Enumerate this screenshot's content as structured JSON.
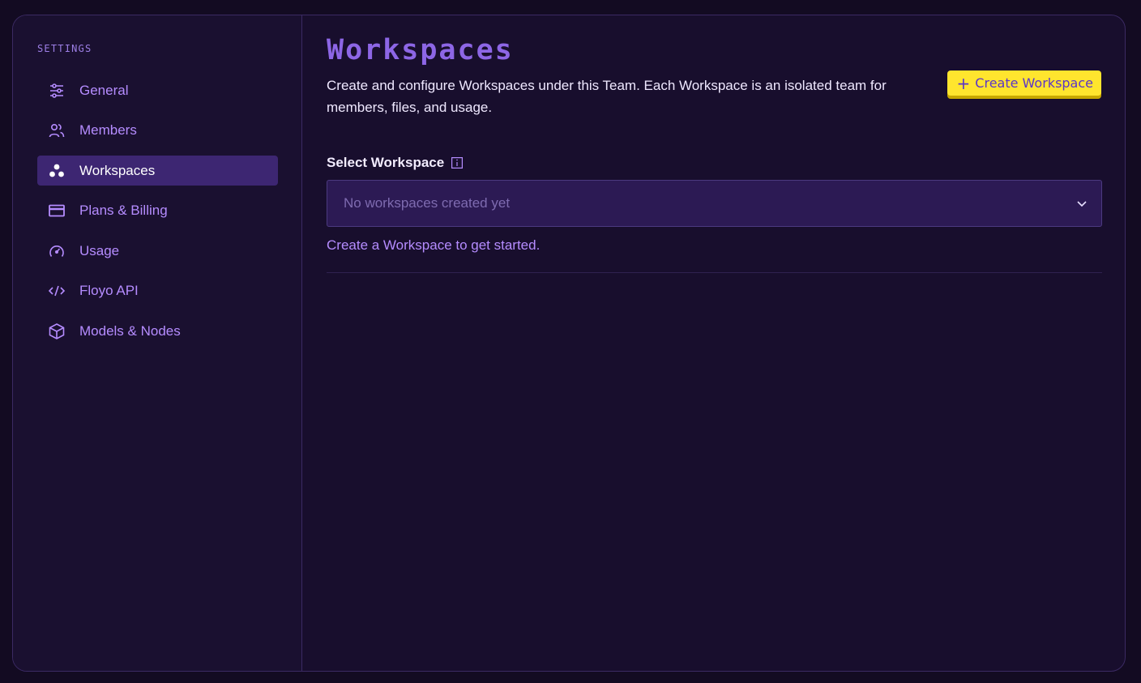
{
  "sidebar": {
    "heading": "SETTINGS",
    "items": [
      {
        "label": "General",
        "icon": "sliders-icon",
        "active": false
      },
      {
        "label": "Members",
        "icon": "users-icon",
        "active": false
      },
      {
        "label": "Workspaces",
        "icon": "workspaces-icon",
        "active": true
      },
      {
        "label": "Plans & Billing",
        "icon": "credit-card-icon",
        "active": false
      },
      {
        "label": "Usage",
        "icon": "gauge-icon",
        "active": false
      },
      {
        "label": "Floyo API",
        "icon": "code-icon",
        "active": false
      },
      {
        "label": "Models & Nodes",
        "icon": "cube-icon",
        "active": false
      }
    ]
  },
  "main": {
    "title": "Workspaces",
    "description": "Create and configure Workspaces under this Team. Each Workspace is an isolated team for members, files, and usage.",
    "create_button": "Create Workspace",
    "select_label": "Select Workspace",
    "select_placeholder": "No workspaces created yet",
    "hint": "Create a Workspace to get started."
  },
  "colors": {
    "background": "#130b22",
    "panel": "#180e2d",
    "accent_purple": "#b58cff",
    "active_item": "#3d2672",
    "button_yellow": "#ffe52e",
    "title_purple": "#8d66e6"
  }
}
